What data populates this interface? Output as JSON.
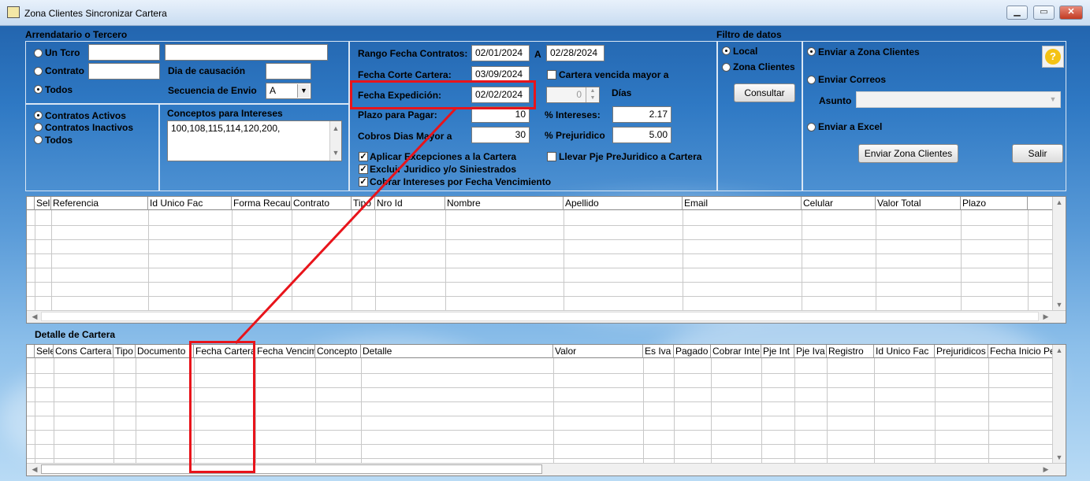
{
  "window": {
    "title": "Zona Clientes Sincronizar Cartera",
    "controls": [
      "▁",
      "▭",
      "✕"
    ]
  },
  "arrendatario": {
    "title": "Arrendatario o Tercero",
    "un_tcro_label": "Un Tcro",
    "contrato_label": "Contrato",
    "todos_label": "Todos",
    "dia_causacion_label": "Dia de causación",
    "secuencia_label": "Secuencia de Envio",
    "secuencia_value": "A"
  },
  "contratos": {
    "activos": "Contratos Activos",
    "inactivos": "Contratos Inactivos",
    "todos": "Todos"
  },
  "conceptos": {
    "title": "Conceptos para Intereses",
    "value": "100,108,115,114,120,200,"
  },
  "rango": {
    "label": "Rango Fecha Contratos:",
    "desde": "02/01/2024",
    "a_label": "A",
    "hasta": "02/28/2024",
    "corte_label": "Fecha Corte Cartera:",
    "corte_value": "03/09/2024",
    "expedicion_label": "Fecha Expedición:",
    "expedicion_value": "02/02/2024",
    "plazo_label": "Plazo para Pagar:",
    "plazo_value": "10",
    "cobros_label": "Cobros Dias Mayor a",
    "cobros_value": "30"
  },
  "cartera": {
    "vencida_label": "Cartera vencida mayor a",
    "dias_value": "0",
    "dias_label": "Días",
    "intereses_label": "% Intereses:",
    "intereses_value": "2.17",
    "prejuridico_label": "% Prejuridico",
    "prejuridico_value": "5.00",
    "llevar_label": "Llevar Pje PreJuridico a Cartera"
  },
  "opciones": {
    "aplicar": "Aplicar Excepciones a la Cartera",
    "excluir": "Excluir Juridico y/o Siniestrados",
    "cobrar": "Cobrar Intereses por Fecha Vencimiento"
  },
  "filtro": {
    "title": "Filtro de datos",
    "local": "Local",
    "zona": "Zona Clientes",
    "consultar": "Consultar"
  },
  "envio": {
    "enviar_zona": "Enviar a Zona Clientes",
    "enviar_correos": "Enviar Correos",
    "asunto_label": "Asunto",
    "enviar_excel": "Enviar a Excel",
    "enviar_zona_button": "Enviar Zona Clientes",
    "salir": "Salir",
    "help": "?"
  },
  "grid1": {
    "columns": [
      "Sel",
      "Referencia",
      "Id Unico Fac",
      "Forma Recau",
      "Contrato",
      "Tipo",
      "Nro Id",
      "Nombre",
      "Apellido",
      "Email",
      "Celular",
      "Valor Total",
      "Plazo"
    ]
  },
  "detalle": {
    "title": "Detalle de Cartera",
    "columns": [
      "Sele",
      "Cons Cartera",
      "Tipo",
      "Documento",
      "Fecha Cartera",
      "Fecha Vencim",
      "Concepto",
      "Detalle",
      "Valor",
      "Es Iva",
      "Pagado",
      "Cobrar Inte",
      "Pje Int",
      "Pje Iva",
      "Registro",
      "Id Unico Fac",
      "Prejuridicos",
      "Fecha Inicio Pe"
    ]
  },
  "colors": {
    "highlight": "#e8141b",
    "panel": "#2f7ac7"
  }
}
